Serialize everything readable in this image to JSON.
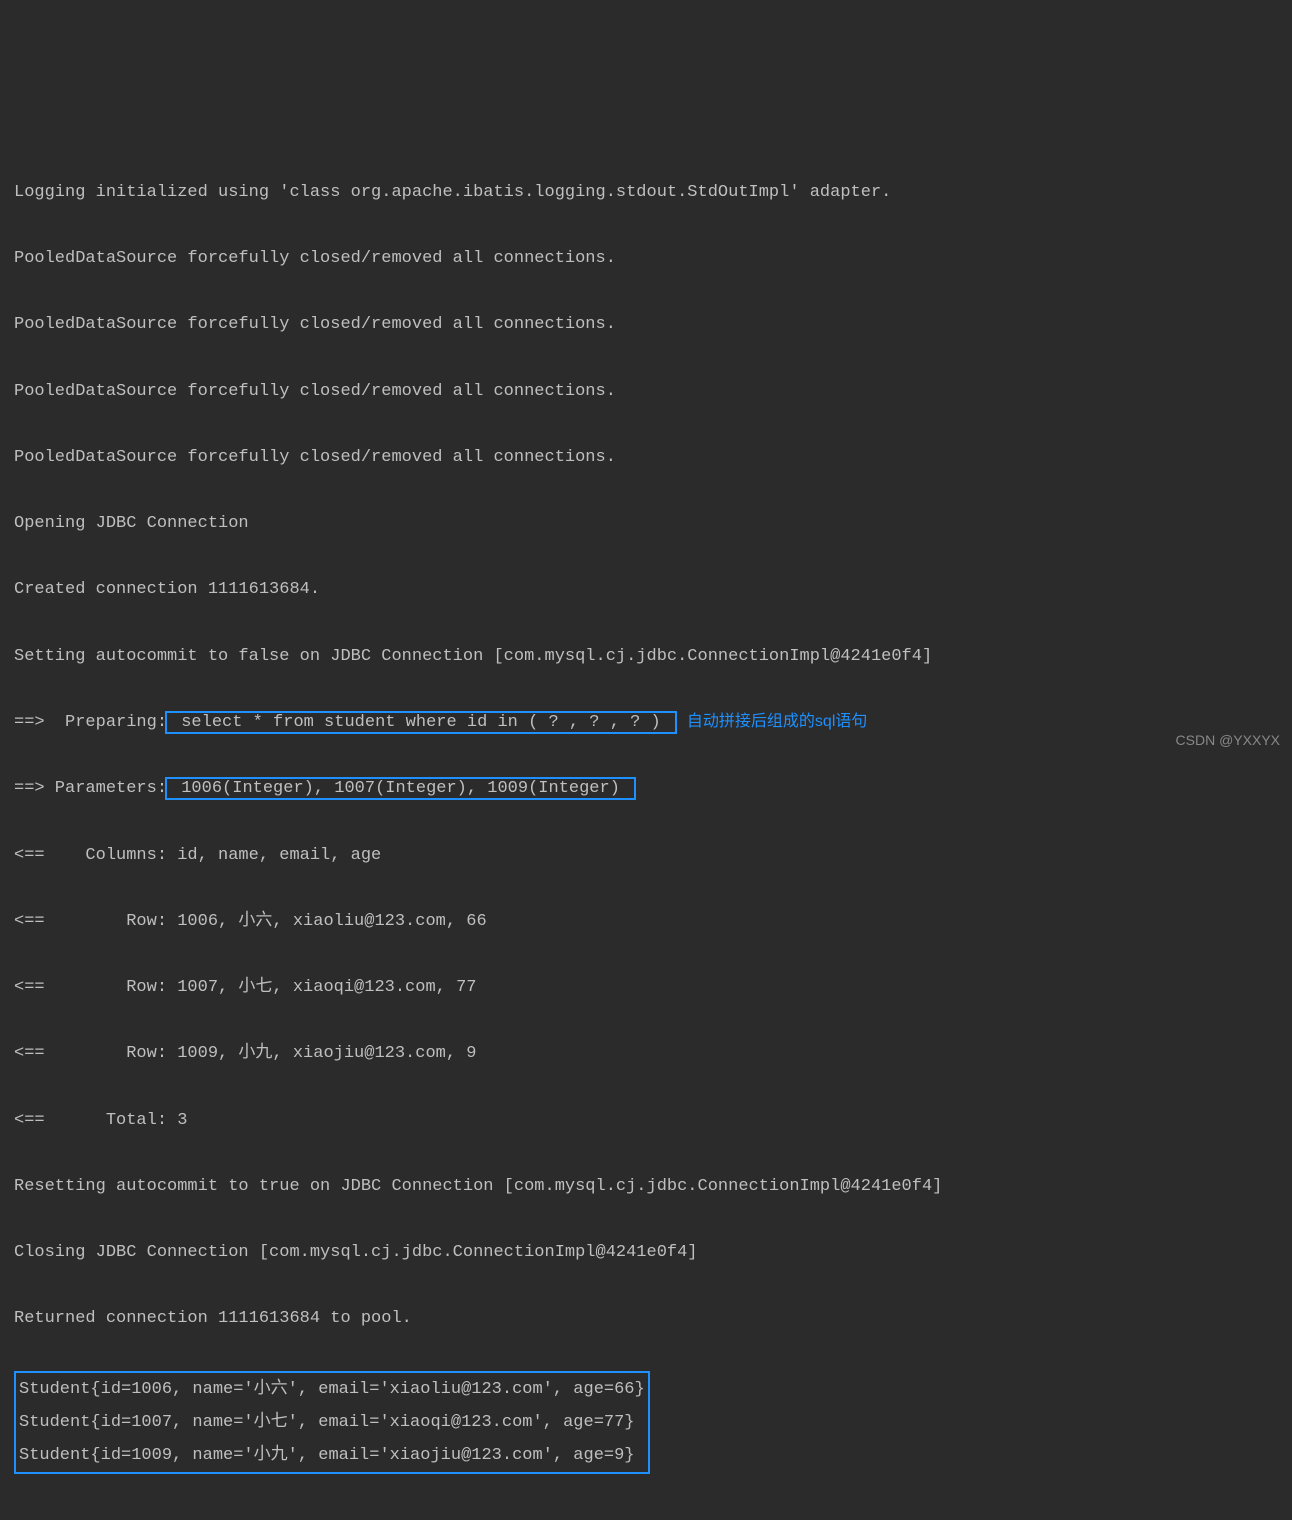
{
  "log": {
    "l1": "Logging initialized using 'class org.apache.ibatis.logging.stdout.StdOutImpl' adapter.",
    "l2": "PooledDataSource forcefully closed/removed all connections.",
    "l3": "PooledDataSource forcefully closed/removed all connections.",
    "l4": "PooledDataSource forcefully closed/removed all connections.",
    "l5": "PooledDataSource forcefully closed/removed all connections.",
    "l6": "Opening JDBC Connection",
    "l7": "Created connection 1111613684.",
    "l8": "Setting autocommit to false on JDBC Connection [com.mysql.cj.jdbc.ConnectionImpl@4241e0f4]",
    "l9_prefix": "==>  Preparing:",
    "l9_sql": " select * from student where id in ( ? , ? , ? ) ",
    "l9_note": "自动拼接后组成的sql语句",
    "l10_prefix": "==> Parameters:",
    "l10_params": " 1006(Integer), 1007(Integer), 1009(Integer) ",
    "l11": "<==    Columns: id, name, email, age",
    "l12": "<==        Row: 1006, 小六, xiaoliu@123.com, 66",
    "l13": "<==        Row: 1007, 小七, xiaoqi@123.com, 77",
    "l14": "<==        Row: 1009, 小九, xiaojiu@123.com, 9",
    "l15": "<==      Total: 3",
    "l16": "Resetting autocommit to true on JDBC Connection [com.mysql.cj.jdbc.ConnectionImpl@4241e0f4]",
    "l17": "Closing JDBC Connection [com.mysql.cj.jdbc.ConnectionImpl@4241e0f4]",
    "l18": "Returned connection 1111613684 to pool.",
    "r1": "Student{id=1006, name='小六', email='xiaoliu@123.com', age=66}",
    "r2": "Student{id=1007, name='小七', email='xiaoqi@123.com', age=77}",
    "r3": "Student{id=1009, name='小九', email='xiaojiu@123.com', age=9}"
  },
  "watermark": "CSDN @YXXYX"
}
